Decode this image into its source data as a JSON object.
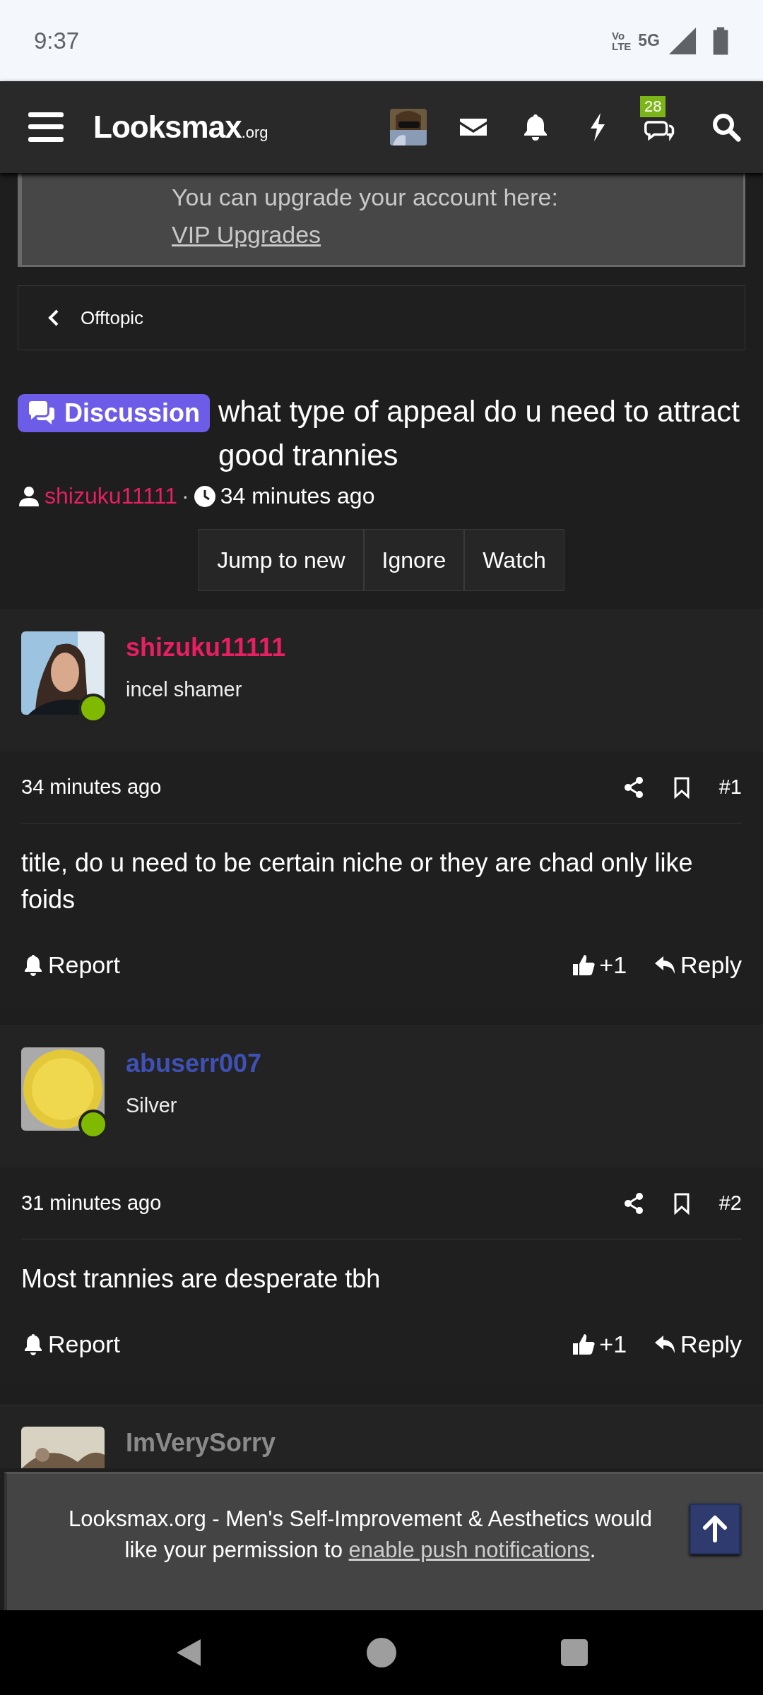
{
  "status_bar": {
    "time": "9:37",
    "network_top": "Vo",
    "network_bottom": "LTE",
    "network_type": "5G"
  },
  "nav": {
    "logo": "Looksmax",
    "logo_suffix": ".org",
    "conversations_badge": "28"
  },
  "notice": {
    "text": "You can upgrade your account here: ",
    "link": "VIP Upgrades"
  },
  "breadcrumb": {
    "label": "Offtopic"
  },
  "thread": {
    "prefix": "Discussion",
    "title": "what type of appeal do u need to attract good trannies",
    "author": "shizuku11111",
    "separator": "·",
    "time": "34 minutes ago",
    "actions": [
      "Jump to new",
      "Ignore",
      "Watch"
    ]
  },
  "posts": [
    {
      "kind": "full",
      "username": "shizuku11111",
      "color": "#e91e63",
      "user_title": "incel shamer",
      "online": true,
      "time": "34 minutes ago",
      "number": "#1",
      "body": "title, do u need to be certain niche or they are chad only like foids",
      "report": "Report",
      "likes": "+1",
      "reply": "Reply"
    },
    {
      "kind": "full",
      "username": "abuserr007",
      "color": "#3f51b5",
      "user_title": "Silver",
      "online": true,
      "time": "31 minutes ago",
      "number": "#2",
      "body": "Most trannies are desperate tbh",
      "report": "Report",
      "likes": "+1",
      "reply": "Reply"
    },
    {
      "kind": "partial",
      "username": "ImVerySorry",
      "color": "#8a8a8a"
    }
  ],
  "push_banner": {
    "text": "Looksmax.org - Men's Self-Improvement & Aesthetics would like your permission to ",
    "link": "enable push notifications",
    "after": "."
  }
}
